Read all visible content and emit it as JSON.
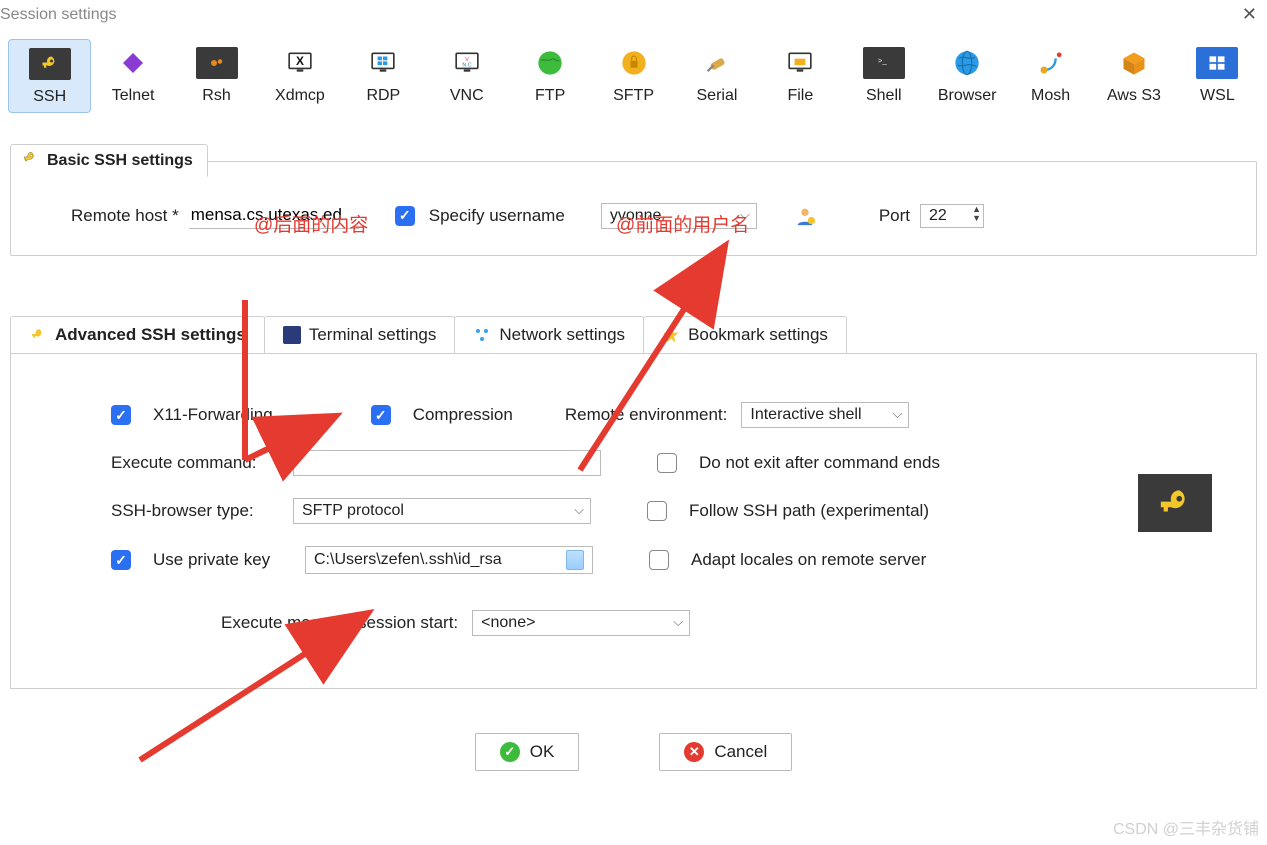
{
  "window": {
    "title": "Session settings"
  },
  "session_types": [
    {
      "id": "ssh",
      "label": "SSH",
      "selected": true
    },
    {
      "id": "telnet",
      "label": "Telnet"
    },
    {
      "id": "rsh",
      "label": "Rsh"
    },
    {
      "id": "xdmcp",
      "label": "Xdmcp"
    },
    {
      "id": "rdp",
      "label": "RDP"
    },
    {
      "id": "vnc",
      "label": "VNC"
    },
    {
      "id": "ftp",
      "label": "FTP"
    },
    {
      "id": "sftp",
      "label": "SFTP"
    },
    {
      "id": "serial",
      "label": "Serial"
    },
    {
      "id": "file",
      "label": "File"
    },
    {
      "id": "shell",
      "label": "Shell"
    },
    {
      "id": "browser",
      "label": "Browser"
    },
    {
      "id": "mosh",
      "label": "Mosh"
    },
    {
      "id": "awss3",
      "label": "Aws S3"
    },
    {
      "id": "wsl",
      "label": "WSL"
    }
  ],
  "basic": {
    "tab_title": "Basic SSH settings",
    "remote_host_label": "Remote host *",
    "remote_host_value": "mensa.cs.utexas.ed",
    "specify_username_label": "Specify username",
    "specify_username_checked": true,
    "username_value": "yvonne",
    "port_label": "Port",
    "port_value": "22"
  },
  "annotations": {
    "host_note": "@后面的内容",
    "user_note": "@前面的用户名"
  },
  "tabs": [
    {
      "id": "adv",
      "label": "Advanced SSH settings",
      "active": true
    },
    {
      "id": "term",
      "label": "Terminal settings"
    },
    {
      "id": "net",
      "label": "Network settings"
    },
    {
      "id": "bm",
      "label": "Bookmark settings"
    }
  ],
  "advanced": {
    "x11_label": "X11-Forwarding",
    "x11_checked": true,
    "compression_label": "Compression",
    "compression_checked": true,
    "remote_env_label": "Remote environment:",
    "remote_env_value": "Interactive shell",
    "exec_cmd_label": "Execute command:",
    "exec_cmd_value": "",
    "no_exit_label": "Do not exit after command ends",
    "no_exit_checked": false,
    "browser_type_label": "SSH-browser type:",
    "browser_type_value": "SFTP protocol",
    "follow_ssh_label": "Follow SSH path (experimental)",
    "follow_ssh_checked": false,
    "use_key_label": "Use private key",
    "use_key_checked": true,
    "key_path_value": "C:\\Users\\zefen\\.ssh\\id_rsa",
    "adapt_locales_label": "Adapt locales on remote server",
    "adapt_locales_checked": false,
    "macro_label": "Execute macro at session start:",
    "macro_value": "<none>"
  },
  "buttons": {
    "ok": "OK",
    "cancel": "Cancel"
  },
  "watermark": "CSDN @三丰杂货铺"
}
